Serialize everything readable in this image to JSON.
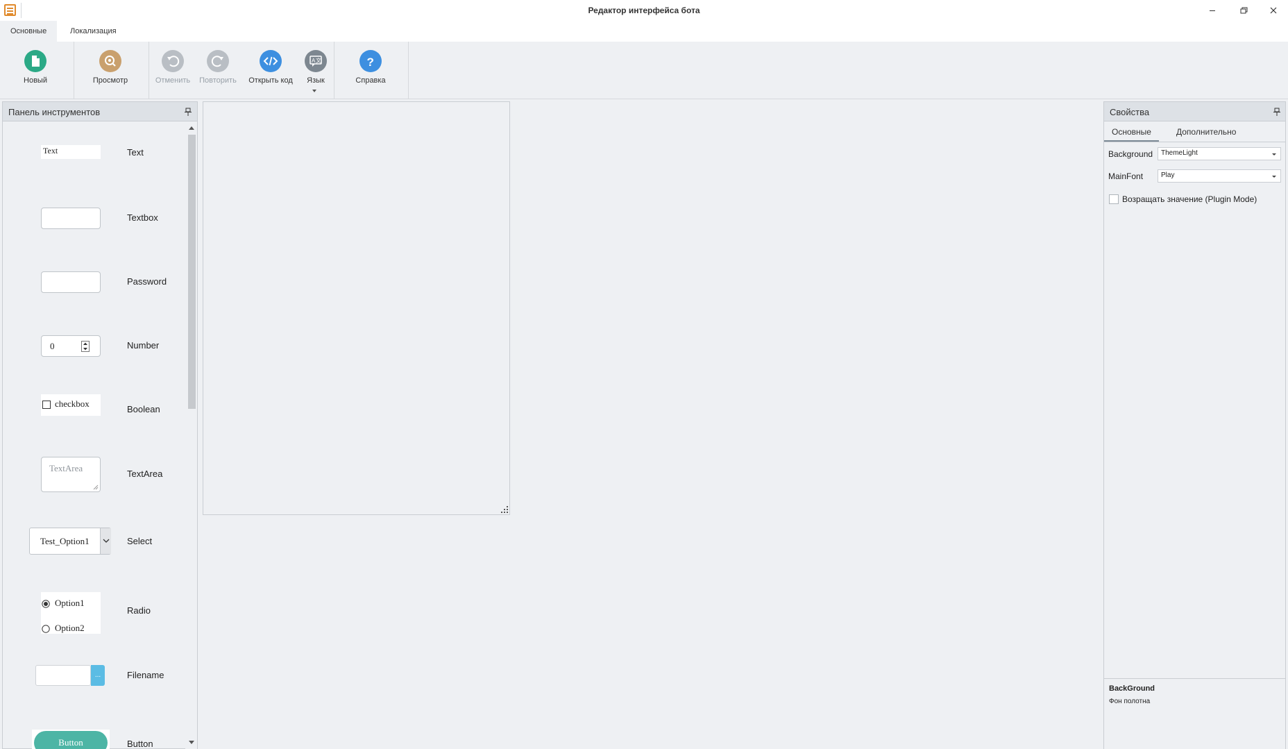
{
  "window": {
    "title": "Редактор интерфейса бота",
    "minimize_icon": "minimize-icon",
    "maximize_icon": "restore-icon",
    "close_icon": "close-icon"
  },
  "ribbon_tabs": [
    "Основные",
    "Локализация"
  ],
  "ribbon": {
    "new": {
      "label": "Новый",
      "color": "#2ba986",
      "icon": "new-file-icon"
    },
    "preview": {
      "label": "Просмотр",
      "color": "#c9a06d",
      "icon": "preview-icon"
    },
    "undo": {
      "label": "Отменить",
      "color": "#b9bec4",
      "icon": "undo-icon",
      "enabled": false
    },
    "redo": {
      "label": "Повторить",
      "color": "#b9bec4",
      "icon": "redo-icon",
      "enabled": false
    },
    "open_code": {
      "label": "Открыть код",
      "color": "#3d8fe0",
      "icon": "code-icon"
    },
    "language": {
      "label": "Язык",
      "color": "#7d8790",
      "icon": "language-icon"
    },
    "help": {
      "label": "Справка",
      "color": "#3d8fe0",
      "icon": "help-icon"
    }
  },
  "tools_panel": {
    "title": "Панель инструментов",
    "items": [
      {
        "name": "Text",
        "preview_text": "Text"
      },
      {
        "name": "Textbox"
      },
      {
        "name": "Password"
      },
      {
        "name": "Number",
        "preview_value": "0"
      },
      {
        "name": "Boolean",
        "preview_text": "checkbox"
      },
      {
        "name": "TextArea",
        "preview_placeholder": "TextArea"
      },
      {
        "name": "Select",
        "preview_value": "Test_Option1"
      },
      {
        "name": "Radio",
        "options": [
          "Option1",
          "Option2"
        ],
        "selected_index": 0
      },
      {
        "name": "Filename",
        "preview_button": "..."
      },
      {
        "name": "Button",
        "preview_text": "Button",
        "preview_color": "#4db5a5"
      }
    ]
  },
  "properties_panel": {
    "title": "Свойства",
    "tabs": [
      "Основные",
      "Дополнительно"
    ],
    "props": [
      {
        "label": "Background",
        "value": "ThemeLight"
      },
      {
        "label": "MainFont",
        "value": "Play"
      }
    ],
    "return_value": {
      "label": "Возращать значение (Plugin Mode)",
      "checked": false
    },
    "description": {
      "title": "BackGround",
      "text": "Фон полотна"
    }
  }
}
